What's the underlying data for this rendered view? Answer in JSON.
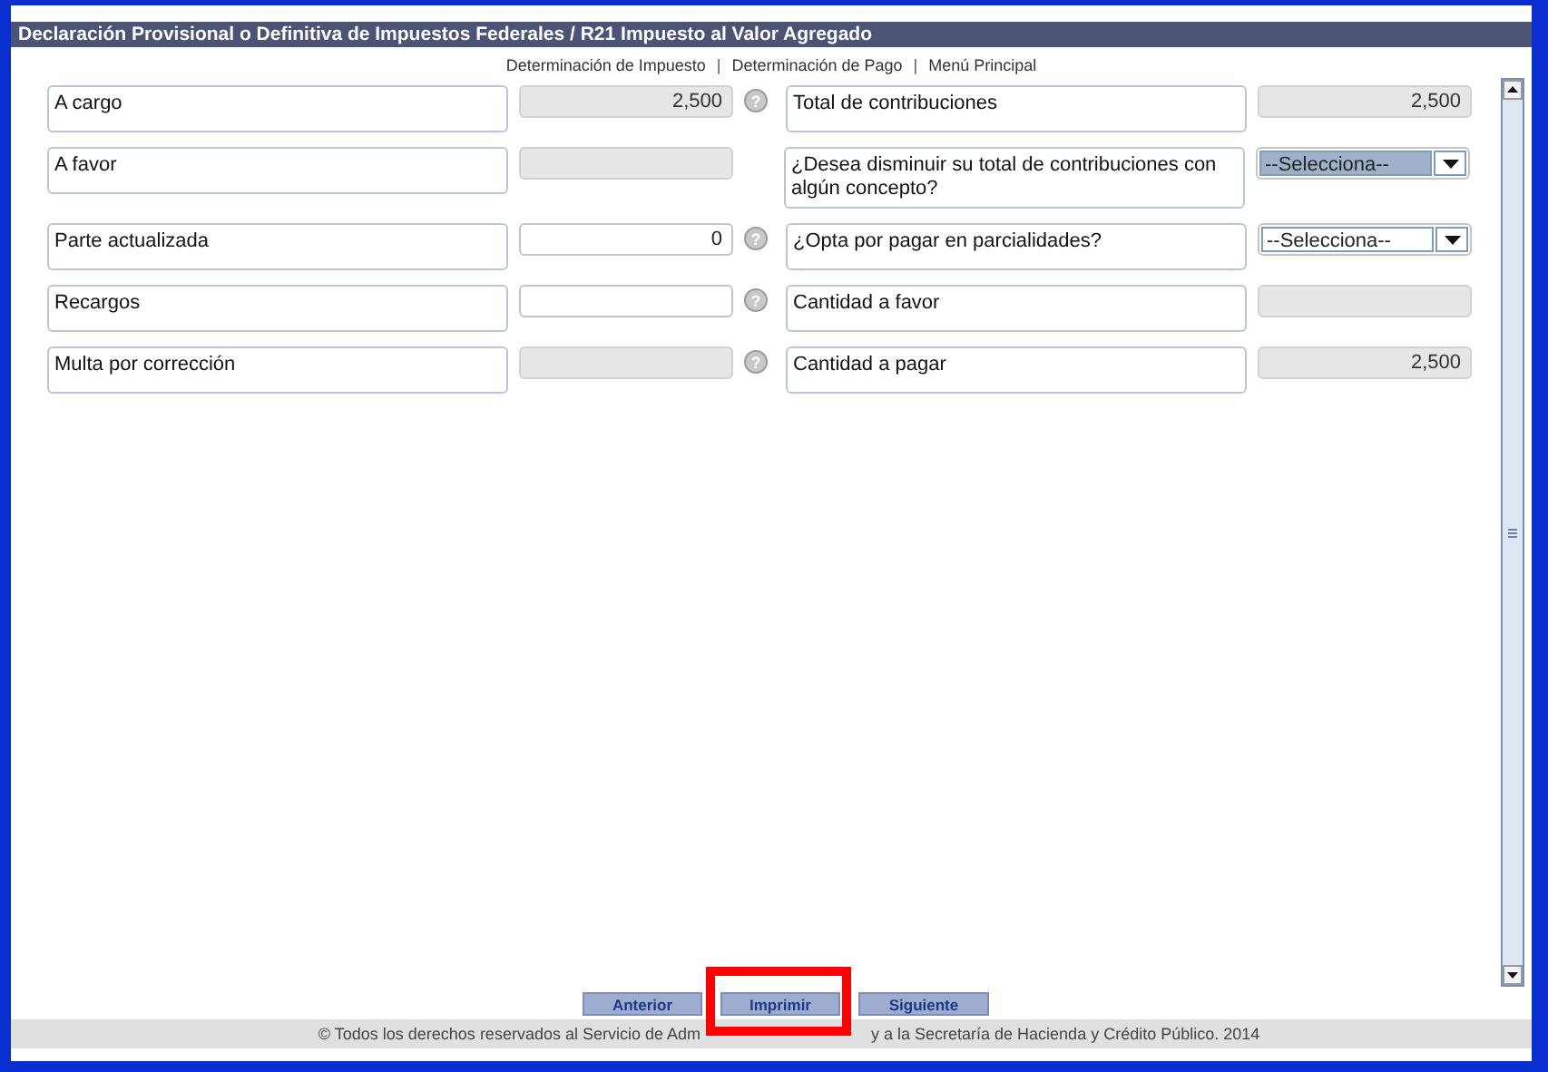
{
  "window": {
    "title": "Declaración Provisional o Definitiva de Impuestos Federales / R21 Impuesto al Valor Agregado"
  },
  "nav_links": [
    {
      "label": "Determinación de Impuesto",
      "separator": "|"
    },
    {
      "label": "Determinación de Pago",
      "separator": "|"
    },
    {
      "label": "Menú Principal"
    }
  ],
  "rows": [
    {
      "left": {
        "label": "A cargo",
        "kind": "input",
        "value": "2,500",
        "disabled": true,
        "help": "?"
      },
      "right": {
        "label": "Total de contribuciones",
        "kind": "input",
        "value": "2,500",
        "disabled": true
      }
    },
    {
      "left": {
        "label": "A favor",
        "kind": "input",
        "disabled": true
      },
      "right": {
        "label": "¿Desea disminuir su total de contribuciones con algún concepto?",
        "kind": "select",
        "value": "--Selecciona--",
        "highlighted": true
      }
    },
    {
      "left": {
        "label": "Parte actualizada",
        "kind": "input",
        "value": "0",
        "disabled": false,
        "help": "?"
      },
      "right": {
        "label": "¿Opta por pagar en parcialidades?",
        "kind": "select",
        "value": "--Selecciona--",
        "highlighted": false
      }
    },
    {
      "left": {
        "label": "Recargos",
        "kind": "input",
        "disabled": false,
        "help": "?"
      },
      "right": {
        "label": "Cantidad a favor",
        "kind": "input",
        "disabled": true
      }
    },
    {
      "left": {
        "label": "Multa por corrección",
        "kind": "input",
        "disabled": true,
        "help": "?"
      },
      "right": {
        "label": "Cantidad a pagar",
        "kind": "input",
        "value": "2,500",
        "disabled": true
      }
    }
  ],
  "buttons": [
    {
      "label": "Anterior"
    },
    {
      "label": "Imprimir"
    },
    {
      "label": "Siguiente"
    }
  ],
  "footer": {
    "text_left": "© Todos los derechos reservados al Servicio de Adm",
    "text_right": "y a la Secretaría de Hacienda y Crédito Público. 2014"
  }
}
